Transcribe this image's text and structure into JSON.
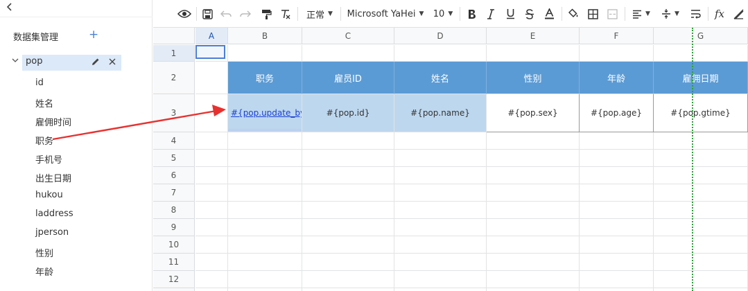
{
  "left_panel": {
    "title": "数据集管理",
    "add_icon": "plus-icon",
    "dataset": {
      "name": "pop",
      "fields": [
        "id",
        "姓名",
        "雇佣时间",
        "职务",
        "手机号",
        "出生日期",
        "hukou",
        "laddress",
        "jperson",
        "性别",
        "年龄"
      ]
    }
  },
  "toolbar": {
    "style_select": "正常",
    "font_select": "Microsoft YaHei",
    "size_select": "10",
    "fx_label": "fx"
  },
  "sheet": {
    "columns": [
      "A",
      "B",
      "C",
      "D",
      "E",
      "F",
      "G"
    ],
    "rows": [
      "1",
      "2",
      "3",
      "4",
      "5",
      "6",
      "7",
      "8",
      "9",
      "10",
      "11",
      "12"
    ],
    "header_row": [
      "职务",
      "雇员ID",
      "姓名",
      "性别",
      "年龄",
      "雇佣日期"
    ],
    "template_row": [
      "#{pop.update_by",
      "#{pop.id}",
      "#{pop.name}",
      "#{pop.sex}",
      "#{pop.age}",
      "#{pop.gtime}"
    ]
  },
  "colors": {
    "header_fill": "#5b9bd5",
    "light_fill": "#bdd7ee",
    "accent": "#4a7fd9",
    "arrow": "#e8312f",
    "guide": "#2e9e3a"
  }
}
